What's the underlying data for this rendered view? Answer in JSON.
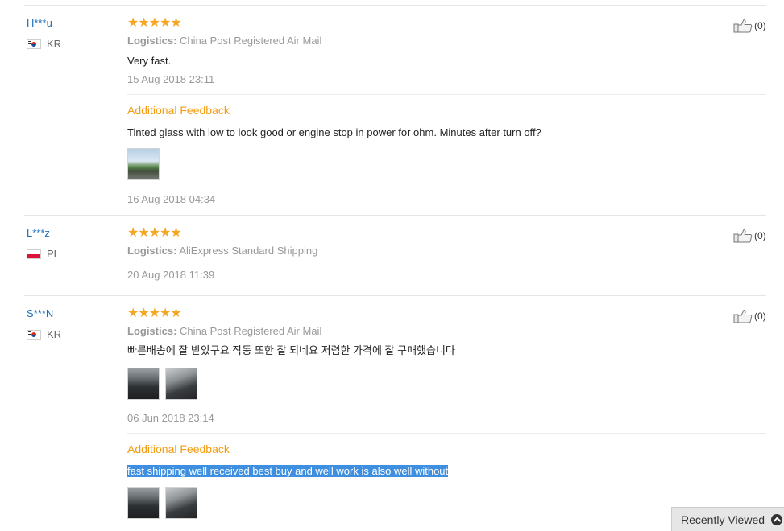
{
  "reviews": [
    {
      "user": "H***u",
      "country": "KR",
      "stars": "★★★★★",
      "logistics_label": "Logistics:",
      "logistics": "China Post Registered Air Mail",
      "text": "Very fast.",
      "date": "15 Aug 2018 23:11",
      "likes": "(0)",
      "additional": {
        "title": "Additional Feedback",
        "text": "Tinted glass with low to look good or engine stop in power for ohm. Minutes after turn off?",
        "date": "16 Aug 2018 04:34"
      }
    },
    {
      "user": "L***z",
      "country": "PL",
      "stars": "★★★★★",
      "logistics_label": "Logistics:",
      "logistics": "AliExpress Standard Shipping",
      "date": "20 Aug 2018 11:39",
      "likes": "(0)"
    },
    {
      "user": "S***N",
      "country": "KR",
      "stars": "★★★★★",
      "logistics_label": "Logistics:",
      "logistics": "China Post Registered Air Mail",
      "text": "빠른배송에 잘 받았구요 작동 또한 잘 되네요 저렴한 가격에 잘 구매했습니다",
      "date": "06 Jun 2018 23:14",
      "likes": "(0)",
      "additional": {
        "title": "Additional Feedback",
        "text": "fast shipping well received best buy and well work is also well without"
      }
    }
  ],
  "footer": {
    "recently_viewed": "Recently Viewed"
  },
  "colors": {
    "star": "#f5a623",
    "username": "#1e6fb8",
    "additional_title": "#f39c12",
    "selection": "#3e8fe0"
  }
}
